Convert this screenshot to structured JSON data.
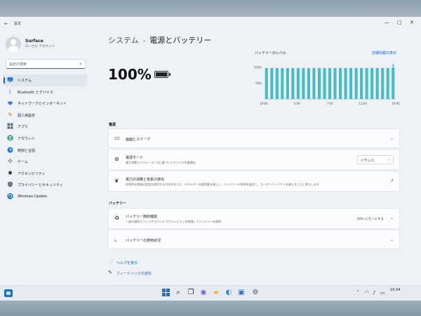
{
  "window": {
    "title": "設定",
    "back_icon": "back-arrow-icon",
    "controls": [
      "minimize-icon",
      "maximize-icon",
      "close-icon"
    ]
  },
  "user": {
    "name": "Surface",
    "account_type": "ローカル アカウント"
  },
  "search": {
    "placeholder": "設定の検索"
  },
  "sidebar": {
    "items": [
      {
        "label": "システム",
        "icon": "monitor-icon",
        "active": true
      },
      {
        "label": "Bluetooth とデバイス",
        "icon": "bluetooth-icon"
      },
      {
        "label": "ネットワークとインターネット",
        "icon": "wifi-icon"
      },
      {
        "label": "個人用設定",
        "icon": "brush-icon"
      },
      {
        "label": "アプリ",
        "icon": "apps-icon"
      },
      {
        "label": "アカウント",
        "icon": "person-icon"
      },
      {
        "label": "時刻と言語",
        "icon": "globe-clock-icon"
      },
      {
        "label": "ゲーム",
        "icon": "gamepad-icon"
      },
      {
        "label": "アクセシビリティ",
        "icon": "accessibility-icon"
      },
      {
        "label": "プライバシーとセキュリティ",
        "icon": "shield-icon"
      },
      {
        "label": "Windows Update",
        "icon": "update-icon"
      }
    ]
  },
  "header": {
    "parent": "システム",
    "separator": "›",
    "title": "電源とバッテリー"
  },
  "battery": {
    "percent": "100%",
    "icon": "battery-charging-icon"
  },
  "battery_level": {
    "title": "バッテリーのレベル",
    "details_link": "詳細情報の表示"
  },
  "chart_data": {
    "type": "bar",
    "title": "バッテリーのレベル",
    "y_ticks": [
      "100%",
      "50%"
    ],
    "x_ticks": [
      "19:00",
      "1:00",
      "7:00",
      "13:00",
      "19:00"
    ],
    "ylim": [
      0,
      100
    ],
    "values": [
      98,
      98,
      98,
      98,
      98,
      98,
      98,
      98,
      98,
      98,
      98,
      98,
      98,
      98,
      98,
      98,
      98,
      98,
      98,
      98,
      98,
      98,
      98,
      98,
      100
    ],
    "color": "#47bcc7",
    "grid": true
  },
  "power_section": {
    "label": "電源",
    "screen_sleep": {
      "title": "画面とスリープ",
      "icon": "screen-sleep-icon"
    },
    "power_mode": {
      "title": "電源モード",
      "desc": "電力消費とパフォーマンスに基づいてデバイスを最適化",
      "value": "バランス",
      "icon": "power-mode-icon"
    },
    "energy_recommendations": {
      "title": "電力の消費と炭素の排出",
      "desc": "効率的な電源の設定を適用する方法を学ぶと、エネルギーの使用量を減らし、バッテリーの寿命を延ばし、カーボンインパクトを減らすことに寄与します",
      "icon": "leaf-icon",
      "action_icon": "external-link-icon"
    }
  },
  "battery_section": {
    "label": "バッテリー",
    "saver": {
      "title": "バッテリー節約機能",
      "desc": "一部の通知とバックグラウンド アクティビティを制限してバッテリーを節約",
      "status": "20% にオンにする",
      "icon": "battery-saver-icon"
    },
    "usage": {
      "title": "バッテリーの使用状況",
      "icon": "chart-icon"
    }
  },
  "help": {
    "get_help": "ヘルプを表示",
    "feedback": "フィードバックの送信",
    "help_icon": "help-icon",
    "feedback_icon": "feedback-icon"
  },
  "taskbar": {
    "apps": [
      {
        "icon": "start-icon",
        "color": "#1f6fd0"
      },
      {
        "icon": "search-icon",
        "color": "#222222"
      },
      {
        "icon": "task-view-icon",
        "color": "#222222"
      },
      {
        "icon": "chat-icon",
        "color": "#6a5bd0"
      },
      {
        "icon": "file-explorer-icon",
        "color": "#f2b530"
      },
      {
        "icon": "edge-icon",
        "color": "#1a8ad0"
      },
      {
        "icon": "store-icon",
        "color": "#3a6fd0"
      },
      {
        "icon": "settings-icon",
        "color": "#555555"
      }
    ],
    "time": "19:34"
  },
  "colors": {
    "accent": "#1666c8",
    "chart_bar": "#47bcc7"
  }
}
